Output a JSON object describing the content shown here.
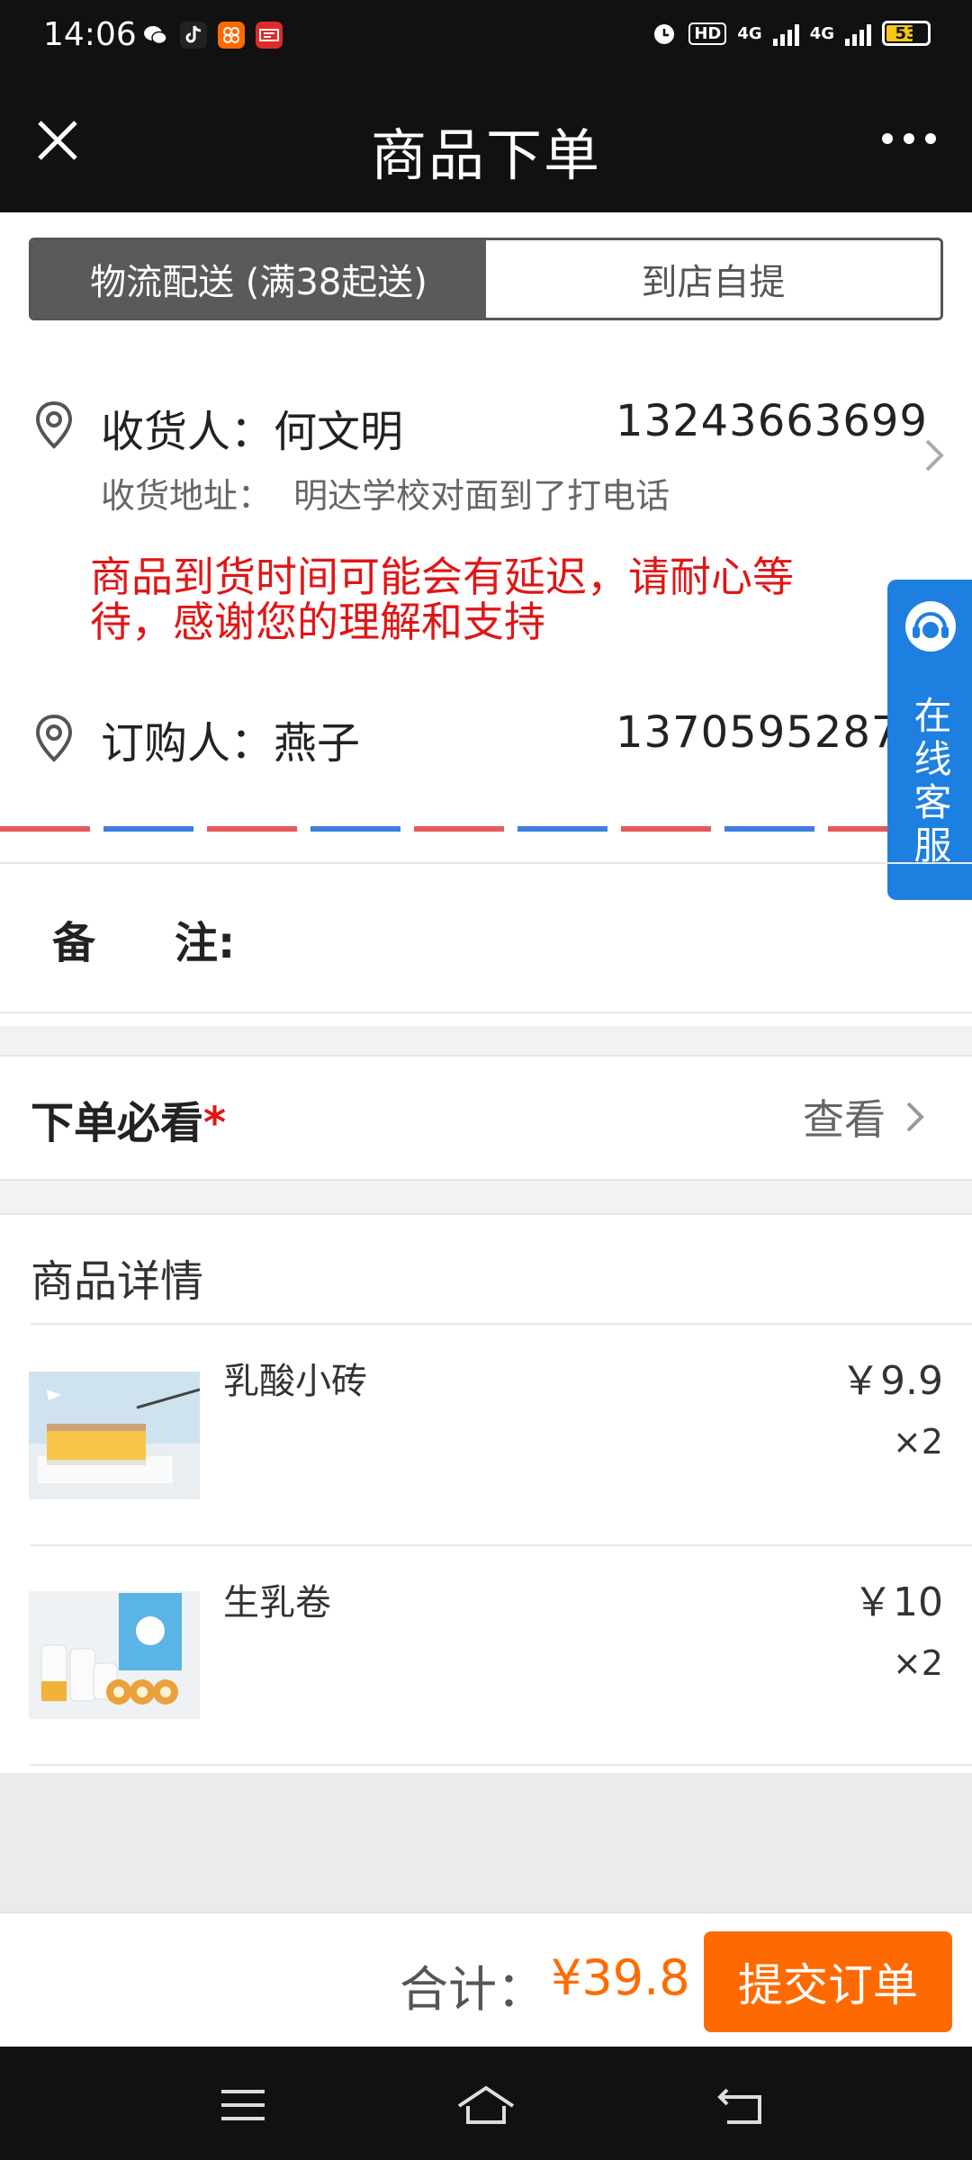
{
  "status_bar": {
    "time": "14:06",
    "network_label": "4G",
    "battery": "53",
    "hd": "HD"
  },
  "header": {
    "title": "商品下单"
  },
  "delivery_tabs": [
    {
      "label": "物流配送 (满38起送)",
      "active": true
    },
    {
      "label": "到店自提",
      "active": false
    }
  ],
  "recipient": {
    "label": "收货人：何文明",
    "phone": "13243663699",
    "address_label": "收货地址：",
    "address": "明达学校对面到了打电话"
  },
  "notice": "商品到货时间可能会有延迟，请耐心等待，感谢您的理解和支持",
  "orderer": {
    "label": "订购人：燕子",
    "phone": "13705952876"
  },
  "customer_service": {
    "label": "在线客服"
  },
  "remarks": {
    "label_a": "备",
    "label_b": "注:"
  },
  "must_read": {
    "label": "下单必看",
    "required_mark": "*",
    "view_label": "查看"
  },
  "details": {
    "title": "商品详情",
    "items": [
      {
        "name": "乳酸小砖",
        "price": "￥9.9",
        "qty": "×2"
      },
      {
        "name": "生乳卷",
        "price": "￥10",
        "qty": "×2"
      }
    ]
  },
  "footer": {
    "total_label": "合计：",
    "total_value": "¥39.8",
    "submit_label": "提交订单"
  },
  "colors": {
    "accent": "#ff6a00",
    "notice_red": "#e01616",
    "service_blue": "#1d7fe0",
    "header_bg": "#111111"
  }
}
